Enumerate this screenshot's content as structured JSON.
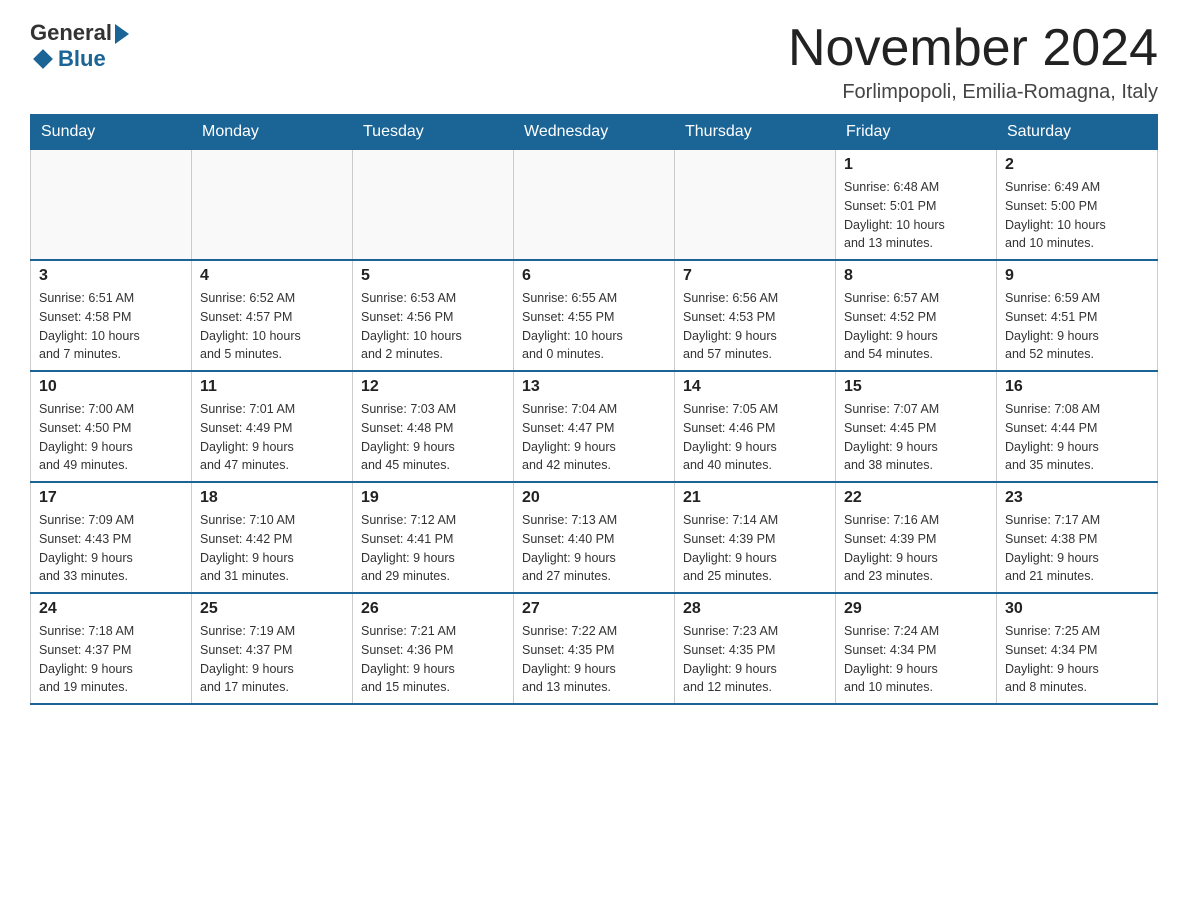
{
  "logo": {
    "general": "General",
    "blue": "Blue"
  },
  "title": "November 2024",
  "location": "Forlimpopoli, Emilia-Romagna, Italy",
  "days_of_week": [
    "Sunday",
    "Monday",
    "Tuesday",
    "Wednesday",
    "Thursday",
    "Friday",
    "Saturday"
  ],
  "weeks": [
    [
      {
        "day": "",
        "info": ""
      },
      {
        "day": "",
        "info": ""
      },
      {
        "day": "",
        "info": ""
      },
      {
        "day": "",
        "info": ""
      },
      {
        "day": "",
        "info": ""
      },
      {
        "day": "1",
        "info": "Sunrise: 6:48 AM\nSunset: 5:01 PM\nDaylight: 10 hours\nand 13 minutes."
      },
      {
        "day": "2",
        "info": "Sunrise: 6:49 AM\nSunset: 5:00 PM\nDaylight: 10 hours\nand 10 minutes."
      }
    ],
    [
      {
        "day": "3",
        "info": "Sunrise: 6:51 AM\nSunset: 4:58 PM\nDaylight: 10 hours\nand 7 minutes."
      },
      {
        "day": "4",
        "info": "Sunrise: 6:52 AM\nSunset: 4:57 PM\nDaylight: 10 hours\nand 5 minutes."
      },
      {
        "day": "5",
        "info": "Sunrise: 6:53 AM\nSunset: 4:56 PM\nDaylight: 10 hours\nand 2 minutes."
      },
      {
        "day": "6",
        "info": "Sunrise: 6:55 AM\nSunset: 4:55 PM\nDaylight: 10 hours\nand 0 minutes."
      },
      {
        "day": "7",
        "info": "Sunrise: 6:56 AM\nSunset: 4:53 PM\nDaylight: 9 hours\nand 57 minutes."
      },
      {
        "day": "8",
        "info": "Sunrise: 6:57 AM\nSunset: 4:52 PM\nDaylight: 9 hours\nand 54 minutes."
      },
      {
        "day": "9",
        "info": "Sunrise: 6:59 AM\nSunset: 4:51 PM\nDaylight: 9 hours\nand 52 minutes."
      }
    ],
    [
      {
        "day": "10",
        "info": "Sunrise: 7:00 AM\nSunset: 4:50 PM\nDaylight: 9 hours\nand 49 minutes."
      },
      {
        "day": "11",
        "info": "Sunrise: 7:01 AM\nSunset: 4:49 PM\nDaylight: 9 hours\nand 47 minutes."
      },
      {
        "day": "12",
        "info": "Sunrise: 7:03 AM\nSunset: 4:48 PM\nDaylight: 9 hours\nand 45 minutes."
      },
      {
        "day": "13",
        "info": "Sunrise: 7:04 AM\nSunset: 4:47 PM\nDaylight: 9 hours\nand 42 minutes."
      },
      {
        "day": "14",
        "info": "Sunrise: 7:05 AM\nSunset: 4:46 PM\nDaylight: 9 hours\nand 40 minutes."
      },
      {
        "day": "15",
        "info": "Sunrise: 7:07 AM\nSunset: 4:45 PM\nDaylight: 9 hours\nand 38 minutes."
      },
      {
        "day": "16",
        "info": "Sunrise: 7:08 AM\nSunset: 4:44 PM\nDaylight: 9 hours\nand 35 minutes."
      }
    ],
    [
      {
        "day": "17",
        "info": "Sunrise: 7:09 AM\nSunset: 4:43 PM\nDaylight: 9 hours\nand 33 minutes."
      },
      {
        "day": "18",
        "info": "Sunrise: 7:10 AM\nSunset: 4:42 PM\nDaylight: 9 hours\nand 31 minutes."
      },
      {
        "day": "19",
        "info": "Sunrise: 7:12 AM\nSunset: 4:41 PM\nDaylight: 9 hours\nand 29 minutes."
      },
      {
        "day": "20",
        "info": "Sunrise: 7:13 AM\nSunset: 4:40 PM\nDaylight: 9 hours\nand 27 minutes."
      },
      {
        "day": "21",
        "info": "Sunrise: 7:14 AM\nSunset: 4:39 PM\nDaylight: 9 hours\nand 25 minutes."
      },
      {
        "day": "22",
        "info": "Sunrise: 7:16 AM\nSunset: 4:39 PM\nDaylight: 9 hours\nand 23 minutes."
      },
      {
        "day": "23",
        "info": "Sunrise: 7:17 AM\nSunset: 4:38 PM\nDaylight: 9 hours\nand 21 minutes."
      }
    ],
    [
      {
        "day": "24",
        "info": "Sunrise: 7:18 AM\nSunset: 4:37 PM\nDaylight: 9 hours\nand 19 minutes."
      },
      {
        "day": "25",
        "info": "Sunrise: 7:19 AM\nSunset: 4:37 PM\nDaylight: 9 hours\nand 17 minutes."
      },
      {
        "day": "26",
        "info": "Sunrise: 7:21 AM\nSunset: 4:36 PM\nDaylight: 9 hours\nand 15 minutes."
      },
      {
        "day": "27",
        "info": "Sunrise: 7:22 AM\nSunset: 4:35 PM\nDaylight: 9 hours\nand 13 minutes."
      },
      {
        "day": "28",
        "info": "Sunrise: 7:23 AM\nSunset: 4:35 PM\nDaylight: 9 hours\nand 12 minutes."
      },
      {
        "day": "29",
        "info": "Sunrise: 7:24 AM\nSunset: 4:34 PM\nDaylight: 9 hours\nand 10 minutes."
      },
      {
        "day": "30",
        "info": "Sunrise: 7:25 AM\nSunset: 4:34 PM\nDaylight: 9 hours\nand 8 minutes."
      }
    ]
  ]
}
